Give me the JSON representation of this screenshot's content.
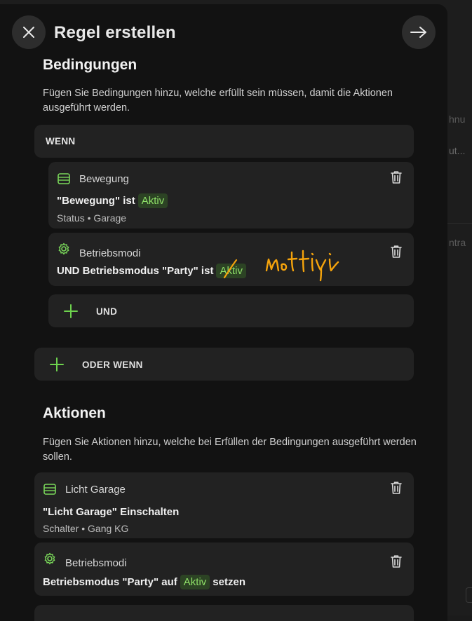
{
  "header": {
    "title": "Regel erstellen",
    "close_icon": "close-icon",
    "next_icon": "arrow-right-icon"
  },
  "background": {
    "text1": "hnu",
    "text2": "ut...",
    "text3": "ntra"
  },
  "conditions": {
    "heading": "Bedingungen",
    "description": "Fügen Sie Bedingungen hinzu, welche erfüllt sein müssen, damit die Aktionen ausgeführt werden.",
    "group_label": "WENN",
    "items": [
      {
        "icon": "motion-sensor-icon",
        "title": "Bewegung",
        "main_prefix": "\"Bewegung\" ist",
        "badge": "Aktiv",
        "main_suffix": "",
        "sub": "Status • Garage"
      },
      {
        "icon": "gear-cycle-icon",
        "title": "Betriebsmodi",
        "main_prefix": "UND Betriebsmodus \"Party\" ist",
        "badge": "Aktiv",
        "main_suffix": "",
        "sub": ""
      }
    ],
    "and_label": "UND",
    "or_label": "ODER WENN"
  },
  "actions": {
    "heading": "Aktionen",
    "description": "Fügen Sie Aktionen hinzu, welche bei Erfüllen der Bedingungen ausgeführt werden sollen.",
    "items": [
      {
        "icon": "device-icon",
        "title": "Licht Garage",
        "main_prefix": "\"Licht Garage\" Einschalten",
        "badge": "",
        "main_suffix": "",
        "sub": "Schalter • Gang KG"
      },
      {
        "icon": "gear-cycle-icon",
        "title": "Betriebsmodi",
        "main_prefix": "Betriebsmodus \"Party\" auf",
        "badge": "Aktiv",
        "main_suffix": "setzen",
        "sub": ""
      }
    ]
  },
  "annotation": {
    "handwritten_text": "inaktiv",
    "color": "#f4a30c"
  },
  "colors": {
    "accent_green": "#8fe068",
    "badge_bg": "#2c4324",
    "card_bg": "#222222",
    "modal_bg": "#121212"
  }
}
